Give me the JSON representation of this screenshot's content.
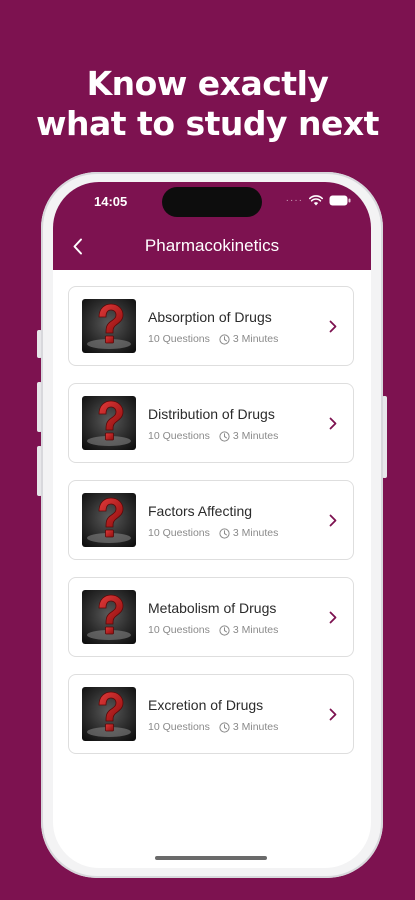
{
  "promo": {
    "headline_line1": "Know exactly",
    "headline_line2": "what to study next"
  },
  "status_bar": {
    "time": "14:05",
    "signal_icon": "signal-dots-icon",
    "wifi_icon": "wifi-icon",
    "battery_icon": "battery-icon"
  },
  "nav": {
    "back_icon": "chevron-left-icon",
    "title": "Pharmacokinetics"
  },
  "topics": [
    {
      "title": "Absorption of Drugs",
      "questions": "10 Questions",
      "duration": "3 Minutes"
    },
    {
      "title": "Distribution of Drugs",
      "questions": "10 Questions",
      "duration": "3 Minutes"
    },
    {
      "title": "Factors Affecting",
      "questions": "10 Questions",
      "duration": "3 Minutes"
    },
    {
      "title": "Metabolism of Drugs",
      "questions": "10 Questions",
      "duration": "3 Minutes"
    },
    {
      "title": "Excretion of Drugs",
      "questions": "10 Questions",
      "duration": "3 Minutes"
    }
  ],
  "colors": {
    "brand": "#7d1250",
    "card_border": "#dedede",
    "chevron": "#7d1250",
    "meta_text": "#8a8a8a"
  }
}
